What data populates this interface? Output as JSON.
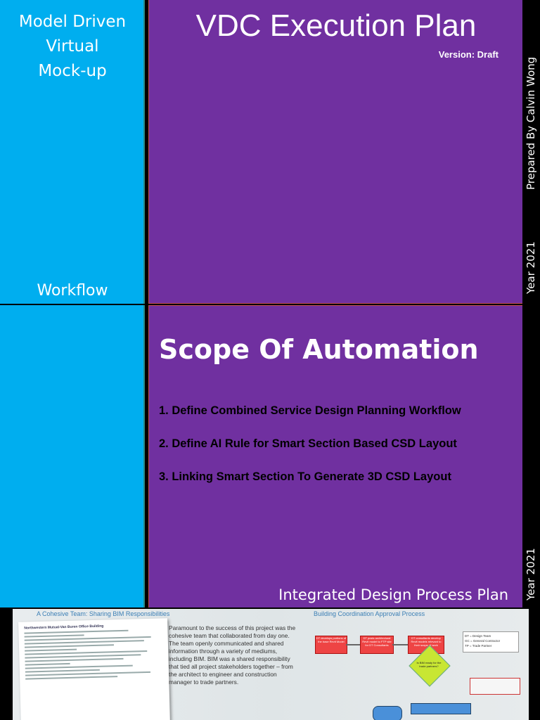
{
  "left_top": {
    "title_lines": [
      "Model Driven",
      "Virtual",
      "Mock-up"
    ],
    "workflow": "Workflow"
  },
  "header": {
    "title": "VDC Execution Plan",
    "version": "Version: Draft"
  },
  "side": {
    "prepared_by": "Prepared By Calvin Wong",
    "year_top": "Year 2021",
    "year_bottom": "Year 2021"
  },
  "scope": {
    "title": "Scope Of Automation",
    "items": [
      "1. Define Combined Service Design Planning Workflow",
      "2. Define AI Rule for Smart Section Based CSD Layout",
      "3. Linking Smart Section To Generate 3D CSD Layout"
    ],
    "footer": "Integrated Design Process Plan"
  },
  "strip": {
    "left_heading": "A Cohesive Team:  Sharing BIM Responsibilities",
    "right_heading": "Building Coordination Approval Process",
    "doc_title": "Northwestern Mutual-Van Buren Office Building",
    "paragraph": "Paramount to the success of this project was the cohesive team that collaborated from day one.  The team openly communicated and shared information through a variety of mediums, including BIM.  BIM was a shared responsibility that tied all project stakeholders together – from the architect to engineer and construction manager to trade partners.",
    "legend_lines": [
      "DT = Design Team",
      "GC = General Contractor",
      "TP = Trade Partner"
    ],
    "flow_boxes": [
      "DT develops portions of the base Revit Model",
      "DT posts architectural Revit model to FTP site for DT Consultants",
      "DT consultants develop Revit models relevant to their scope of work"
    ],
    "decision": "Is BIM ready for the trade partners?"
  },
  "colors": {
    "cyan": "#00aeef",
    "purple": "#7030a0"
  }
}
